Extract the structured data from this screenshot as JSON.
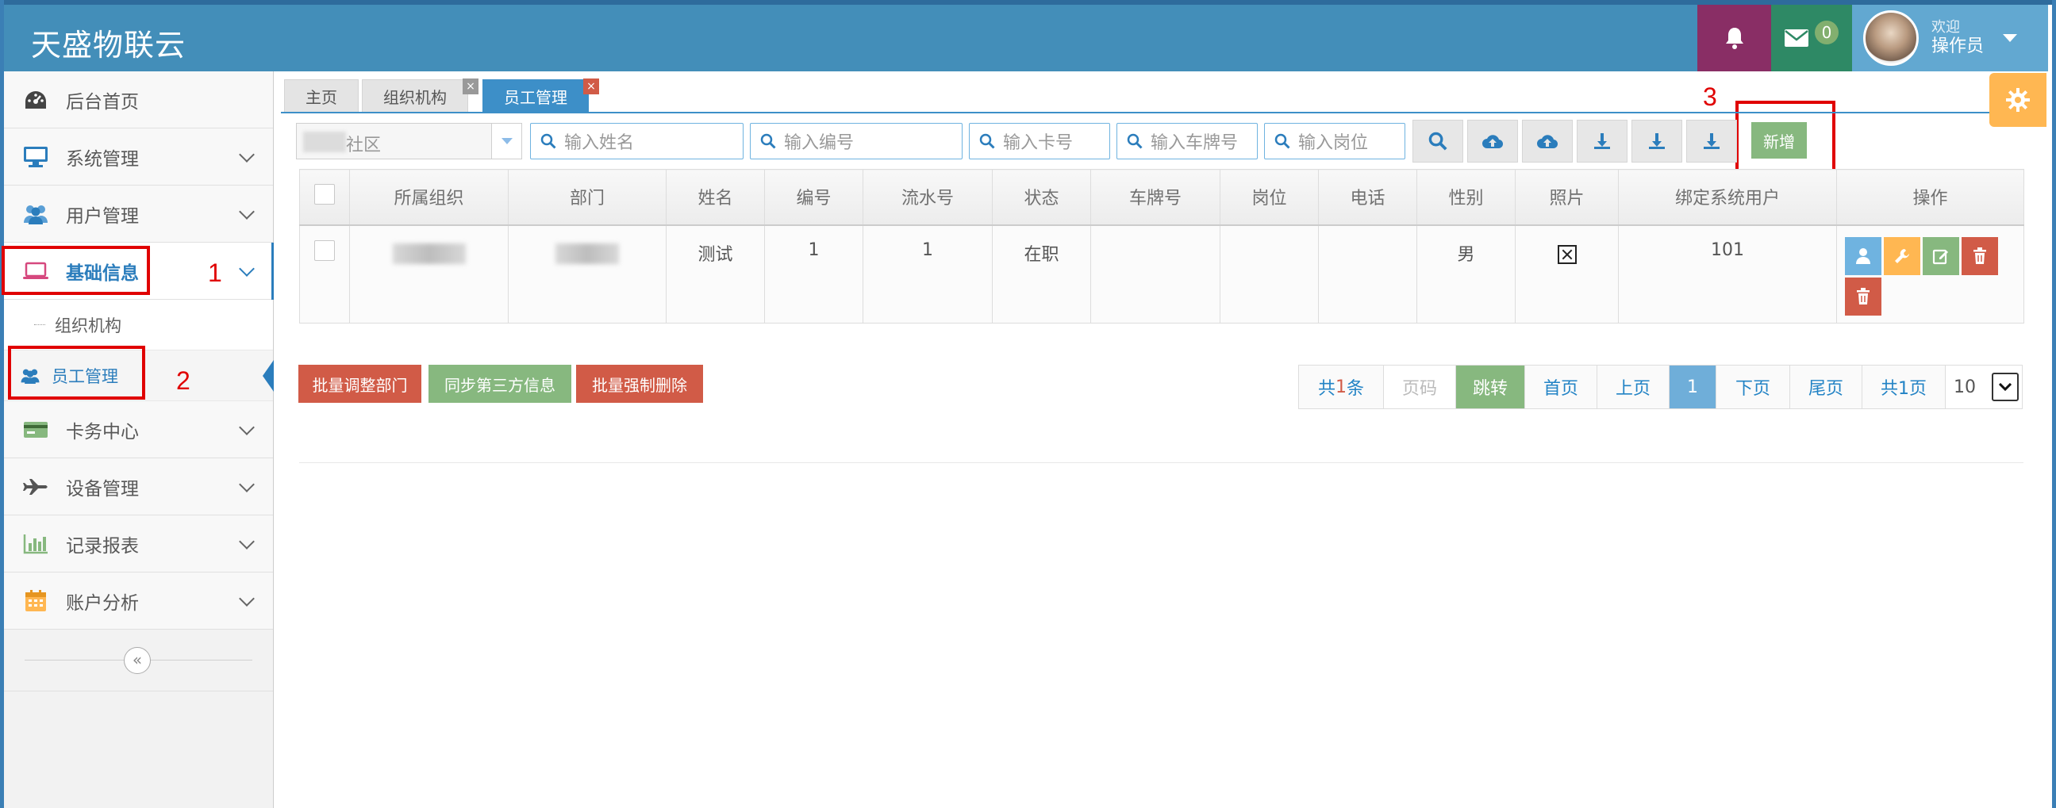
{
  "app": {
    "brand": "天盛物联云"
  },
  "navbar": {
    "bell_icon": "bell-icon",
    "mail_icon": "envelope-icon",
    "mail_count": "0",
    "welcome": "欢迎",
    "username": "操作员",
    "colors": {
      "bar": "#438eb9",
      "bell": "#892e65",
      "mail": "#2e8965",
      "user": "#62a8d1"
    }
  },
  "sidebar": {
    "items": [
      {
        "label": "后台首页",
        "icon": "dashboard-icon"
      },
      {
        "label": "系统管理",
        "icon": "desktop-icon"
      },
      {
        "label": "用户管理",
        "icon": "users-icon"
      },
      {
        "label": "基础信息",
        "icon": "laptop-icon"
      },
      {
        "label": "卡务中心",
        "icon": "credit-card-icon"
      },
      {
        "label": "设备管理",
        "icon": "plane-icon"
      },
      {
        "label": "记录报表",
        "icon": "bar-chart-icon"
      },
      {
        "label": "账户分析",
        "icon": "calendar-icon"
      }
    ],
    "sub_items": [
      {
        "label": "组织机构"
      },
      {
        "label": "员工管理",
        "icon": "users-icon"
      }
    ],
    "collapse_symbol": "«"
  },
  "annotations": {
    "n1": "1",
    "n2": "2",
    "n3": "3"
  },
  "tabs": [
    {
      "label": "主页"
    },
    {
      "label": "组织机构",
      "close": "×"
    },
    {
      "label": "员工管理",
      "close": "×"
    }
  ],
  "filters": {
    "community_value": "社区",
    "name_placeholder": "输入姓名",
    "code_placeholder": "输入编号",
    "card_placeholder": "输入卡号",
    "plate_placeholder": "输入车牌号",
    "post_placeholder": "输入岗位",
    "add_label": "新增",
    "toolbar_icons": [
      "search-icon",
      "upload-cloud-icon",
      "upload-cloud-icon",
      "download-icon",
      "download-icon",
      "download-icon"
    ]
  },
  "table": {
    "columns": [
      "所属组织",
      "部门",
      "姓名",
      "编号",
      "流水号",
      "状态",
      "车牌号",
      "岗位",
      "电话",
      "性别",
      "照片",
      "绑定系统用户",
      "操作"
    ],
    "rows": [
      {
        "org": "",
        "dept": "",
        "name": "测试",
        "code": "1",
        "serial": "1",
        "status": "在职",
        "plate": "",
        "post": "",
        "phone": "",
        "gender": "男",
        "photo": "broken-image-icon",
        "bound_user": "101",
        "actions": [
          "user-icon",
          "wrench-icon",
          "edit-icon",
          "trash-icon",
          "trash-icon"
        ]
      }
    ]
  },
  "bottom_buttons": {
    "batch_dept": "批量调整部门",
    "sync_third": "同步第三方信息",
    "force_delete": "批量强制删除"
  },
  "pagination": {
    "total_prefix": "共",
    "total_count": "1",
    "total_suffix": "条",
    "page_input_placeholder": "页码",
    "jump": "跳转",
    "first": "首页",
    "prev": "上页",
    "current": "1",
    "next": "下页",
    "last": "尾页",
    "total_pages": "共1页",
    "page_size": "10"
  }
}
